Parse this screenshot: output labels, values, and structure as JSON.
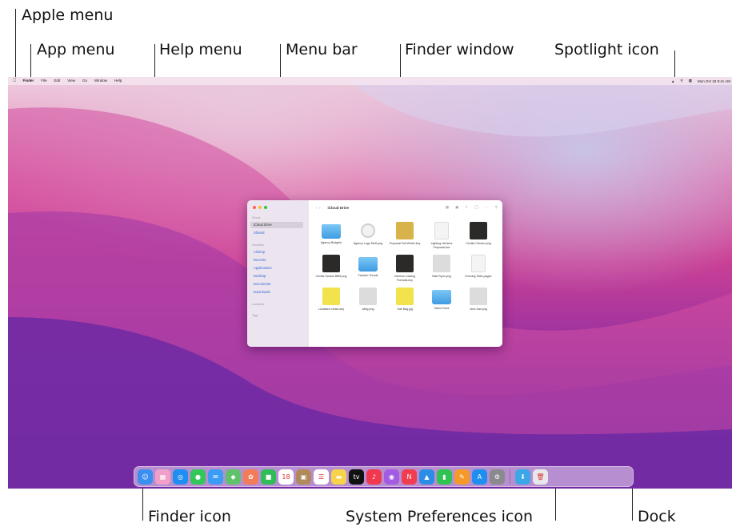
{
  "callouts": {
    "apple_menu": "Apple menu",
    "app_menu": "App menu",
    "help_menu": "Help menu",
    "menu_bar": "Menu bar",
    "finder_window": "Finder window",
    "spotlight_icon": "Spotlight icon",
    "finder_icon": "Finder icon",
    "system_preferences_icon": "System Preferences icon",
    "dock": "Dock"
  },
  "menubar": {
    "apple": "",
    "items": [
      "Finder",
      "File",
      "Edit",
      "View",
      "Go",
      "Window",
      "Help"
    ],
    "clock": "Mon Oct 18  9:41 AM"
  },
  "finder": {
    "title": "iCloud Drive",
    "sidebar": {
      "icloud_heading": "iCloud",
      "icloud_items": [
        "iCloud Drive",
        "Shared"
      ],
      "favorites_heading": "Favorites",
      "favorites_items": [
        "AirDrop",
        "Recents",
        "Applications",
        "Desktop",
        "Documents",
        "Downloads"
      ],
      "locations_heading": "Locations",
      "tags_heading": "Tags"
    },
    "files": [
      {
        "name": "Agency Budgets",
        "kind": "folder"
      },
      {
        "name": "Agency Logo DAH.png",
        "kind": "logo"
      },
      {
        "name": "Proposal Fall Winter.key",
        "kind": "gold"
      },
      {
        "name": "Lighting Vendors Proposal.doc",
        "kind": "doc"
      },
      {
        "name": "Cecilia Clemen.png",
        "kind": "dark"
      },
      {
        "name": "Cecilia Santos BBM.png",
        "kind": "dark"
      },
      {
        "name": "Fashion Trends",
        "kind": "folder"
      },
      {
        "name": "Interiors Casting Portraits.key",
        "kind": "dark"
      },
      {
        "name": "Matt Ryan.png",
        "kind": "bw"
      },
      {
        "name": "Evening Talks.pages",
        "kind": "doc"
      },
      {
        "name": "Locations Notes.key",
        "kind": "yellow"
      },
      {
        "name": "Abby.png",
        "kind": "bw"
      },
      {
        "name": "Tote Bag.jpg",
        "kind": "yellow"
      },
      {
        "name": "Talent Deck",
        "kind": "folder"
      },
      {
        "name": "Vera San.png",
        "kind": "bw"
      }
    ]
  },
  "dock": {
    "apps": [
      {
        "name": "finder",
        "color": "#3b8ff0",
        "glyph": "☺"
      },
      {
        "name": "launchpad",
        "color": "#f0a0c8",
        "glyph": "▦"
      },
      {
        "name": "safari",
        "color": "#1f8ef1",
        "glyph": "◎"
      },
      {
        "name": "messages",
        "color": "#33c75a",
        "glyph": "●"
      },
      {
        "name": "mail",
        "color": "#3a9cf5",
        "glyph": "✉"
      },
      {
        "name": "maps",
        "color": "#5fc26a",
        "glyph": "◆"
      },
      {
        "name": "photos",
        "color": "#f47b5a",
        "glyph": "✿"
      },
      {
        "name": "facetime",
        "color": "#2fbd58",
        "glyph": "■"
      },
      {
        "name": "calendar",
        "color": "#ffffff",
        "glyph": "18"
      },
      {
        "name": "contacts",
        "color": "#b08a5a",
        "glyph": "▣"
      },
      {
        "name": "reminders",
        "color": "#ffffff",
        "glyph": "☰"
      },
      {
        "name": "notes",
        "color": "#f6d34a",
        "glyph": "▬"
      },
      {
        "name": "tv",
        "color": "#111111",
        "glyph": "tv"
      },
      {
        "name": "music",
        "color": "#f2384f",
        "glyph": "♪"
      },
      {
        "name": "podcasts",
        "color": "#a45be3",
        "glyph": "◉"
      },
      {
        "name": "news",
        "color": "#f23d50",
        "glyph": "N"
      },
      {
        "name": "keynote",
        "color": "#2b8de6",
        "glyph": "▲"
      },
      {
        "name": "numbers",
        "color": "#2fc452",
        "glyph": "▮"
      },
      {
        "name": "pages",
        "color": "#f59a2a",
        "glyph": "✎"
      },
      {
        "name": "app-store",
        "color": "#1e8ef0",
        "glyph": "A"
      },
      {
        "name": "system-preferences",
        "color": "#8a8a8e",
        "glyph": "⚙"
      }
    ],
    "trailing": [
      {
        "name": "downloads",
        "color": "#3ba7e8",
        "glyph": "⬇"
      },
      {
        "name": "trash",
        "color": "#e8e8ec",
        "glyph": "🗑"
      }
    ]
  }
}
